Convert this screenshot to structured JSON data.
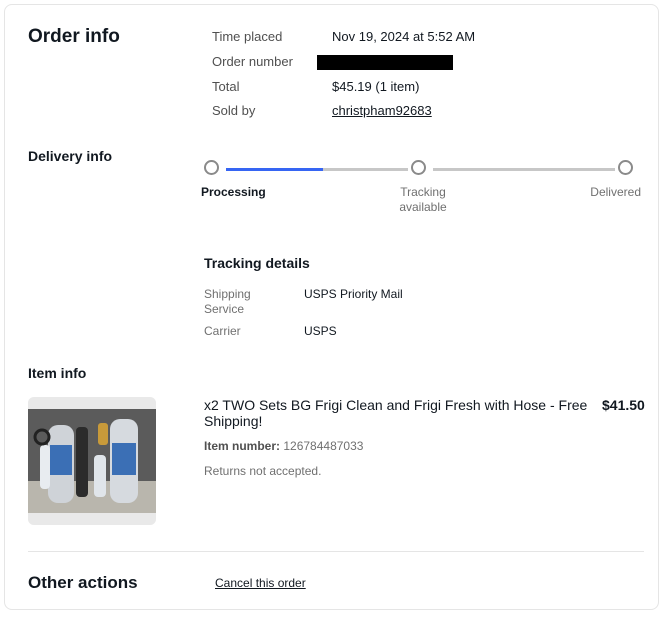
{
  "order_info": {
    "heading": "Order info",
    "rows": [
      {
        "label": "Time placed",
        "value": "Nov 19, 2024 at 5:52 AM"
      },
      {
        "label": "Order number",
        "value": ""
      },
      {
        "label": "Total",
        "value": "$45.19 (1 item)"
      },
      {
        "label": "Sold by",
        "value": "christpham92683"
      }
    ]
  },
  "delivery_info": {
    "heading": "Delivery info",
    "steps": [
      "Processing",
      "Tracking available",
      "Delivered"
    ],
    "progress_fraction": 0.25,
    "active_color": "#3665f3",
    "tracking_details": {
      "title": "Tracking details",
      "rows": [
        {
          "label": "Shipping Service",
          "value": "USPS Priority Mail"
        },
        {
          "label": "Carrier",
          "value": "USPS"
        }
      ]
    }
  },
  "item_info": {
    "heading": "Item info",
    "title": "x2 TWO Sets BG Frigi Clean and Frigi Fresh with Hose - Free Shipping!",
    "price": "$41.50",
    "item_number_label": "Item number:",
    "item_number": "126784487033",
    "returns": "Returns not accepted."
  },
  "other_actions": {
    "heading": "Other actions",
    "cancel_label": "Cancel this order"
  }
}
